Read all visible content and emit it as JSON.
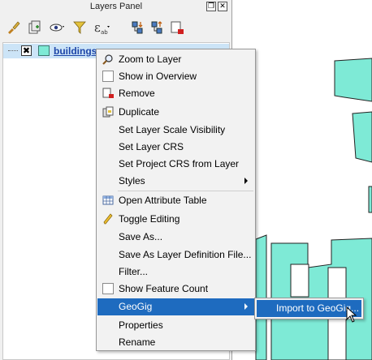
{
  "panel": {
    "title": "Layers Panel",
    "float_icon": "restore-icon",
    "close_icon": "close-icon",
    "toolbar": [
      "paint-brush-icon",
      "add-group-icon",
      "eye-icon",
      "filter-icon",
      "expression-filter-icon",
      "expand-all-icon",
      "collapse-all-icon",
      "remove-layer-icon"
    ]
  },
  "layer": {
    "name": "buildings",
    "visible_mark": "✖",
    "swatch_color": "#7eead6"
  },
  "menu": {
    "items": [
      {
        "label": "Zoom to Layer",
        "icon": "zoom-icon"
      },
      {
        "label": "Show in Overview",
        "icon": "checkbox"
      },
      {
        "label": "Remove",
        "icon": "remove-icon"
      },
      {
        "label": "Duplicate",
        "icon": "duplicate-icon"
      },
      {
        "label": "Set Layer Scale Visibility"
      },
      {
        "label": "Set Layer CRS"
      },
      {
        "label": "Set Project CRS from Layer"
      },
      {
        "label": "Styles",
        "submenu": true
      },
      {
        "label": "Open Attribute Table",
        "icon": "table-icon"
      },
      {
        "label": "Toggle Editing",
        "icon": "pencil-icon"
      },
      {
        "label": "Save As..."
      },
      {
        "label": "Save As Layer Definition File..."
      },
      {
        "label": "Filter..."
      },
      {
        "label": "Show Feature Count",
        "icon": "checkbox"
      },
      {
        "label": "GeoGig",
        "submenu": true,
        "highlighted": true
      },
      {
        "label": "Properties"
      },
      {
        "label": "Rename"
      }
    ]
  },
  "submenu": {
    "label": "Import to GeoGig..."
  },
  "colors": {
    "highlight": "#1e6bbf",
    "polygon_fill": "#7eead6"
  }
}
